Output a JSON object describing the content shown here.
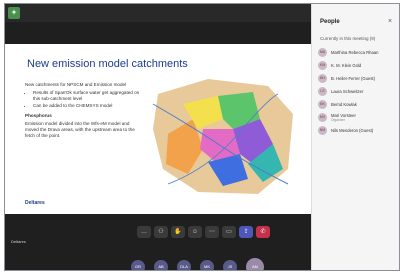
{
  "slide": {
    "title": "New emission model catchments",
    "intro": "New catchments for NPSCM and Emission model",
    "bullets": [
      "Results of SparrOk surface water get aggregated on this sub-catchment level",
      "Can be added to the CHEMSYS model"
    ],
    "heading": "Phosphorus",
    "paragraph": "Emission model divided into the Wfs-eM model and moved the Drava areas, with the upstream area to the fetch of the point.",
    "footer": "Deltares"
  },
  "presenter": {
    "label": "Deltares"
  },
  "controls": [
    {
      "icon": "chat-icon",
      "glyph": "…"
    },
    {
      "icon": "people-icon",
      "glyph": "⚇"
    },
    {
      "icon": "raise-hand-icon",
      "glyph": "✋"
    },
    {
      "icon": "react-icon",
      "glyph": "☺"
    },
    {
      "icon": "more-icon",
      "glyph": "⋯"
    },
    {
      "icon": "camera-icon",
      "glyph": "▭"
    },
    {
      "icon": "share-icon",
      "glyph": "⇪"
    },
    {
      "icon": "leave-icon",
      "glyph": "✆"
    }
  ],
  "tiles": [
    "GR",
    "AB",
    "DLA",
    "MK",
    "JS",
    "AM"
  ],
  "people": {
    "title": "People",
    "section": "Currently in this meeting (9)",
    "list": [
      {
        "initials": "MA",
        "name": "Marthina Rebecca Rhaan",
        "sub": ""
      },
      {
        "initials": "KM",
        "name": "K. M. Klein Gold",
        "sub": ""
      },
      {
        "initials": "BH",
        "name": "B. Heiler-Ferrer (Guest)",
        "sub": ""
      },
      {
        "initials": "LS",
        "name": "Laura Schweitzer",
        "sub": ""
      },
      {
        "initials": "BK",
        "name": "Bernd Kowlak",
        "sub": ""
      },
      {
        "initials": "MV",
        "name": "Mari Vorsteer",
        "sub": "Organizer"
      },
      {
        "initials": "NM",
        "name": "Nils Menderon (Guest)",
        "sub": ""
      }
    ]
  }
}
